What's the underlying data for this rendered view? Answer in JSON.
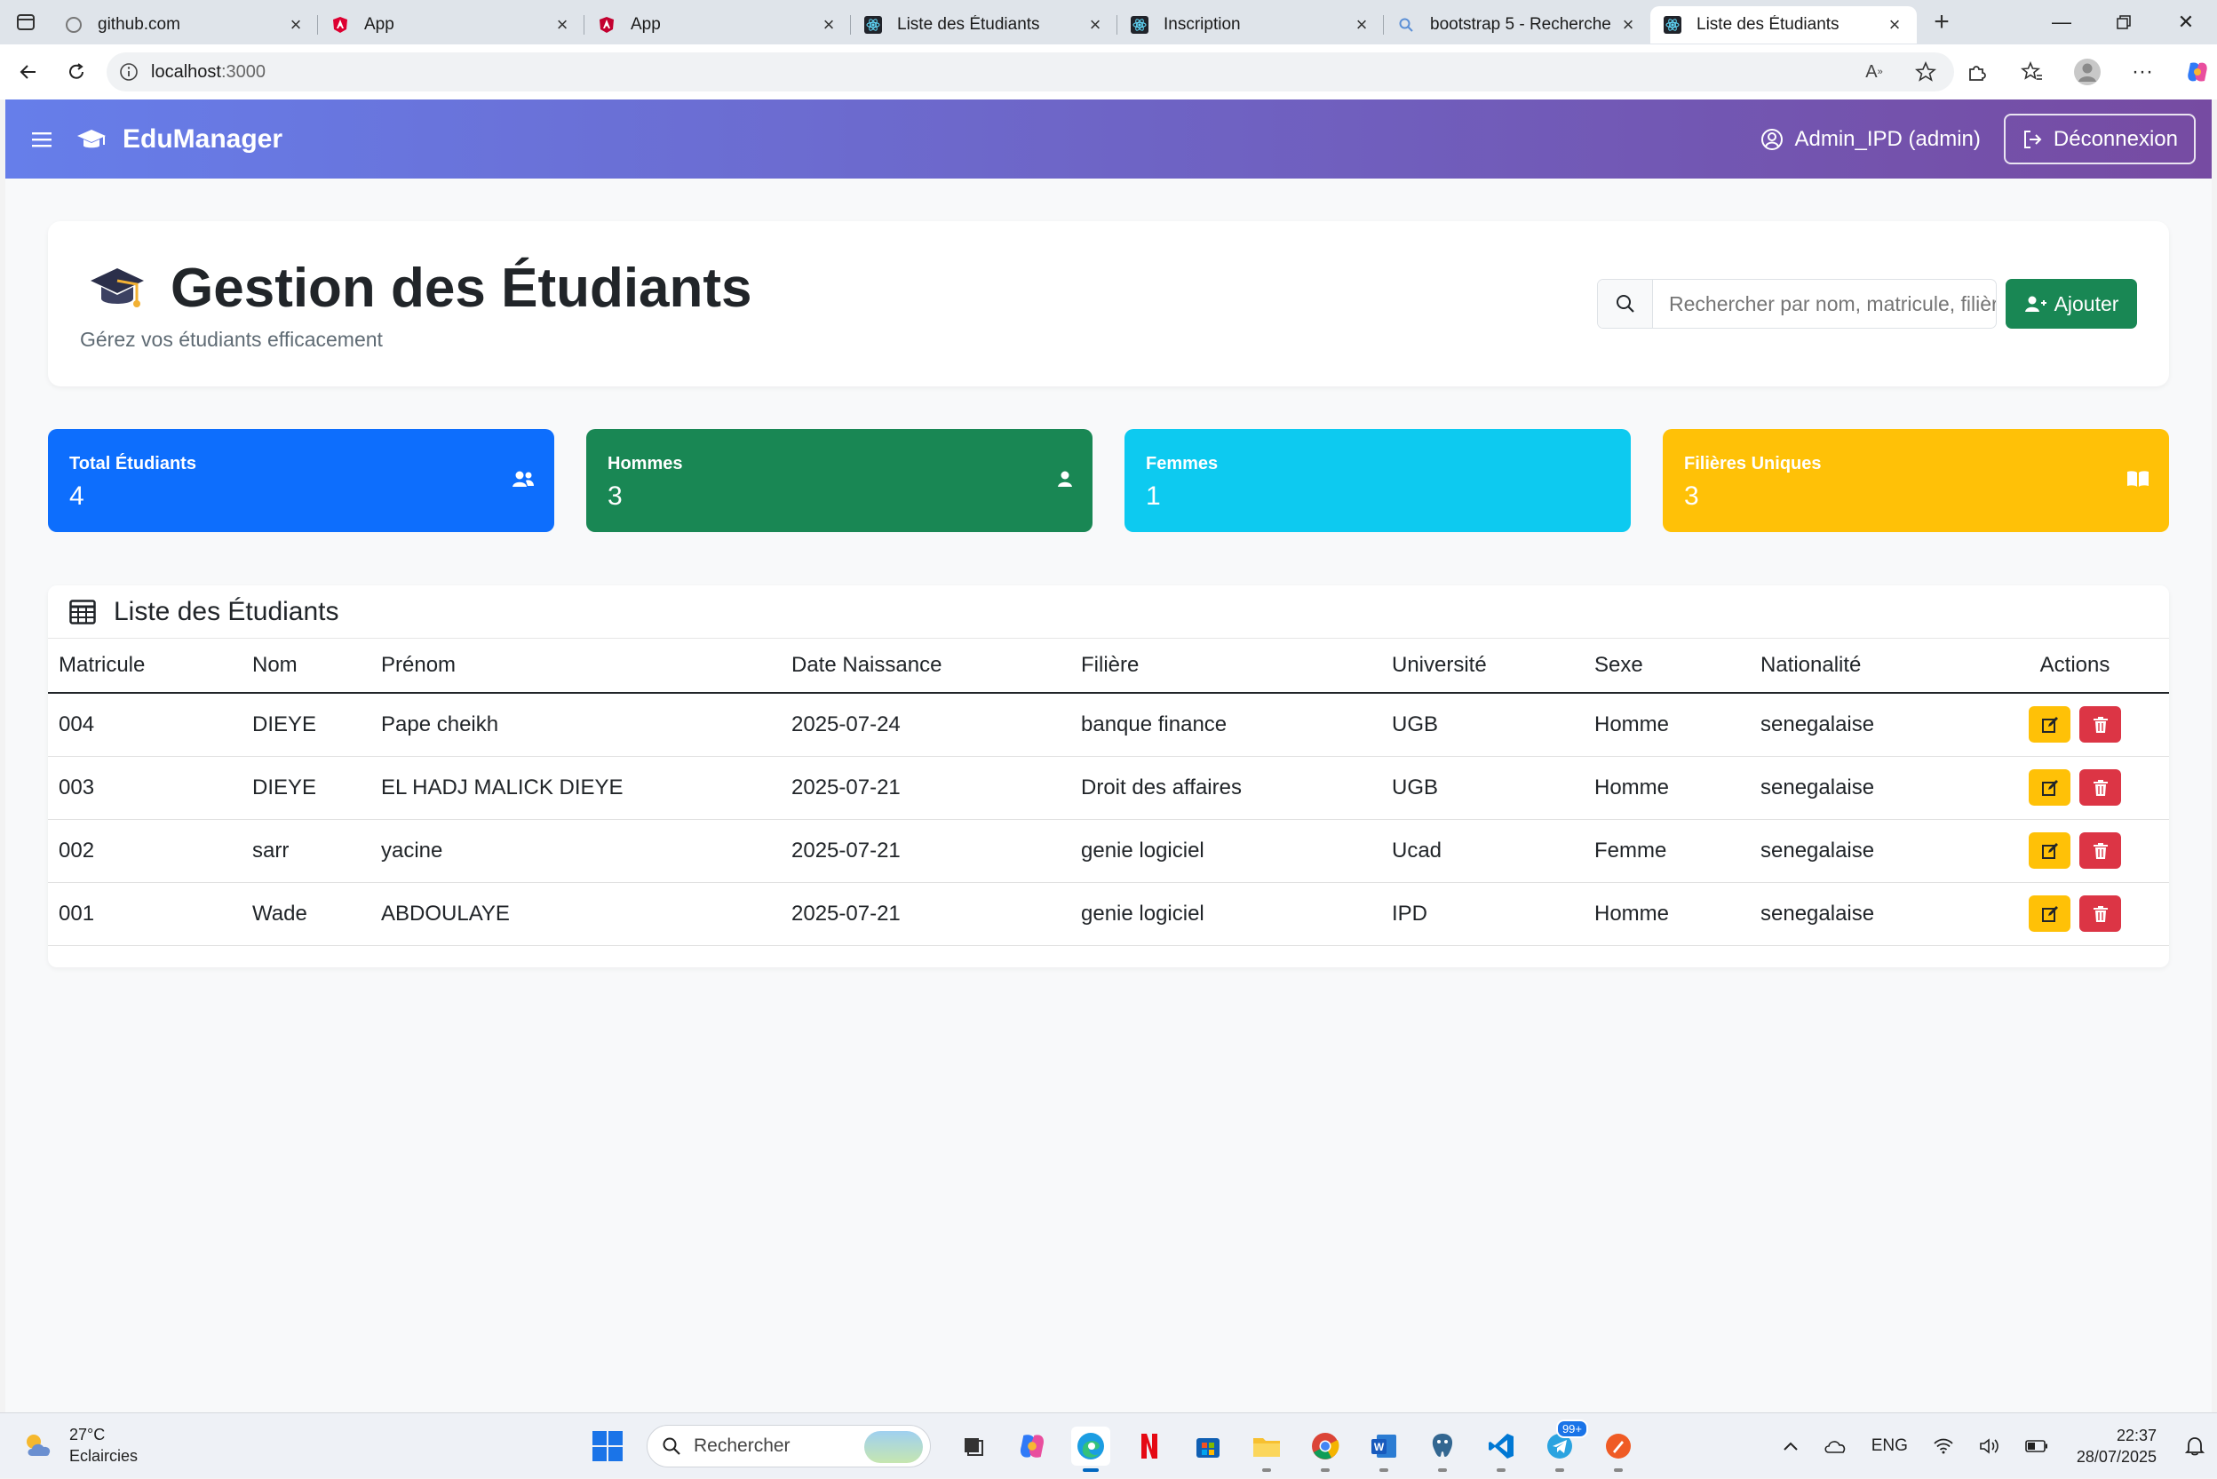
{
  "browser": {
    "tabs": [
      {
        "title": "github.com",
        "icon": "page-icon"
      },
      {
        "title": "App",
        "icon": "angular-icon"
      },
      {
        "title": "App",
        "icon": "angular-icon"
      },
      {
        "title": "Liste des Étudiants",
        "icon": "react-icon"
      },
      {
        "title": "Inscription",
        "icon": "react-icon"
      },
      {
        "title": "bootstrap 5 - Recherche",
        "icon": "search-icon"
      },
      {
        "title": "Liste des Étudiants",
        "icon": "react-icon",
        "active": true
      }
    ],
    "url_host": "localhost",
    "url_port": ":3000"
  },
  "navbar": {
    "brand": "EduManager",
    "user": "Admin_IPD (admin)",
    "logout_label": "Déconnexion",
    "gradient_start": "#667eea",
    "gradient_end": "#764ba2"
  },
  "header": {
    "title": "Gestion des Étudiants",
    "subtitle": "Gérez vos étudiants efficacement",
    "search_placeholder": "Rechercher par nom, matricule, filière...",
    "add_label": "Ajouter"
  },
  "stats": [
    {
      "label": "Total Étudiants",
      "value": "4",
      "color": "#0d6efd",
      "icon": "users-icon"
    },
    {
      "label": "Hommes",
      "value": "3",
      "color": "#198754",
      "icon": "user-icon"
    },
    {
      "label": "Femmes",
      "value": "1",
      "color": "#0dcaf0",
      "icon": "none"
    },
    {
      "label": "Filières Uniques",
      "value": "3",
      "color": "#ffc107",
      "icon": "book-icon"
    }
  ],
  "table": {
    "title": "Liste des Étudiants",
    "headers": [
      "Matricule",
      "Nom",
      "Prénom",
      "Date Naissance",
      "Filière",
      "Université",
      "Sexe",
      "Nationalité",
      "Actions"
    ],
    "rows": [
      [
        "004",
        "DIEYE",
        "Pape cheikh",
        "2025-07-24",
        "banque finance",
        "UGB",
        "Homme",
        "senegalaise"
      ],
      [
        "003",
        "DIEYE",
        "EL HADJ MALICK DIEYE",
        "2025-07-21",
        "Droit des affaires",
        "UGB",
        "Homme",
        "senegalaise"
      ],
      [
        "002",
        "sarr",
        "yacine",
        "2025-07-21",
        "genie logiciel",
        "Ucad",
        "Femme",
        "senegalaise"
      ],
      [
        "001",
        "Wade",
        "ABDOULAYE",
        "2025-07-21",
        "genie logiciel",
        "IPD",
        "Homme",
        "senegalaise"
      ]
    ]
  },
  "taskbar": {
    "temp": "27°C",
    "weather": "Eclaircies",
    "search_placeholder": "Rechercher",
    "lang": "ENG",
    "time": "22:37",
    "date": "28/07/2025",
    "badge": "99+"
  }
}
